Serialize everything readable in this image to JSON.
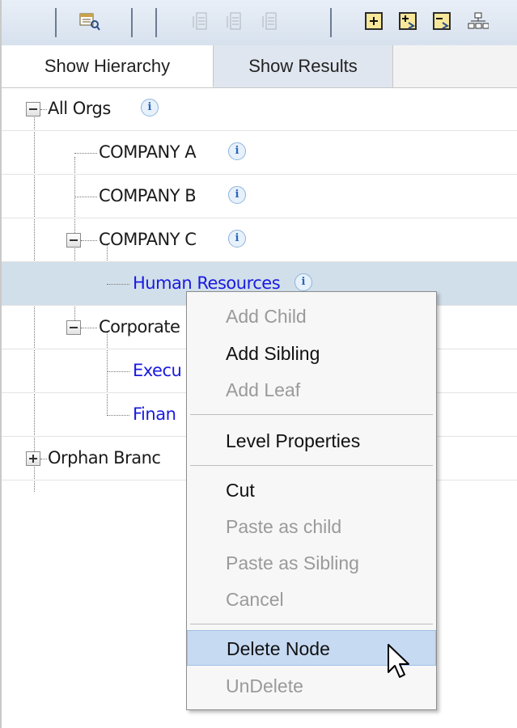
{
  "toolbar": {
    "buttons": [
      "find-icon",
      "add-sibling-above-icon",
      "add-sibling-below-icon",
      "add-leaf-icon",
      "expand-all-icon",
      "expand-node-icon",
      "collapse-node-icon",
      "hierarchy-icon"
    ]
  },
  "tabs": [
    {
      "label": "Show Hierarchy",
      "active": true
    },
    {
      "label": "Show Results",
      "active": false
    }
  ],
  "tree": {
    "info_glyph": "i",
    "nodes": [
      {
        "label": "All Orgs",
        "expander": "minus",
        "level": 0
      },
      {
        "label": "COMPANY A",
        "expander": "none",
        "level": 1
      },
      {
        "label": "COMPANY B",
        "expander": "none",
        "level": 1
      },
      {
        "label": "COMPANY C",
        "expander": "minus",
        "level": 1
      },
      {
        "label": "Human Resources",
        "expander": "none",
        "level": 2,
        "selected": true,
        "link": true
      },
      {
        "label": "Corporate",
        "expander": "minus",
        "level": 1
      },
      {
        "label": "Execu",
        "expander": "none",
        "level": 2,
        "link": true
      },
      {
        "label": "Finan",
        "expander": "none",
        "level": 2,
        "link": true
      },
      {
        "label": "Orphan Branc",
        "expander": "plus",
        "level": 0
      }
    ]
  },
  "context_menu": {
    "groups": [
      [
        {
          "label": "Add Child",
          "enabled": false
        },
        {
          "label": "Add Sibling",
          "enabled": true
        },
        {
          "label": "Add Leaf",
          "enabled": false
        }
      ],
      [
        {
          "label": "Level Properties",
          "enabled": true
        }
      ],
      [
        {
          "label": "Cut",
          "enabled": true
        },
        {
          "label": "Paste as child",
          "enabled": false
        },
        {
          "label": "Paste as Sibling",
          "enabled": false
        },
        {
          "label": "Cancel",
          "enabled": false
        }
      ],
      [
        {
          "label": "Delete Node",
          "enabled": true,
          "highlighted": true
        },
        {
          "label": "UnDelete",
          "enabled": false
        }
      ]
    ]
  },
  "colors": {
    "selected_row": "#d1dfea",
    "menu_highlight": "#c6daf2",
    "link_text": "#1a1ae0",
    "disabled_text": "#9a9a9a"
  }
}
